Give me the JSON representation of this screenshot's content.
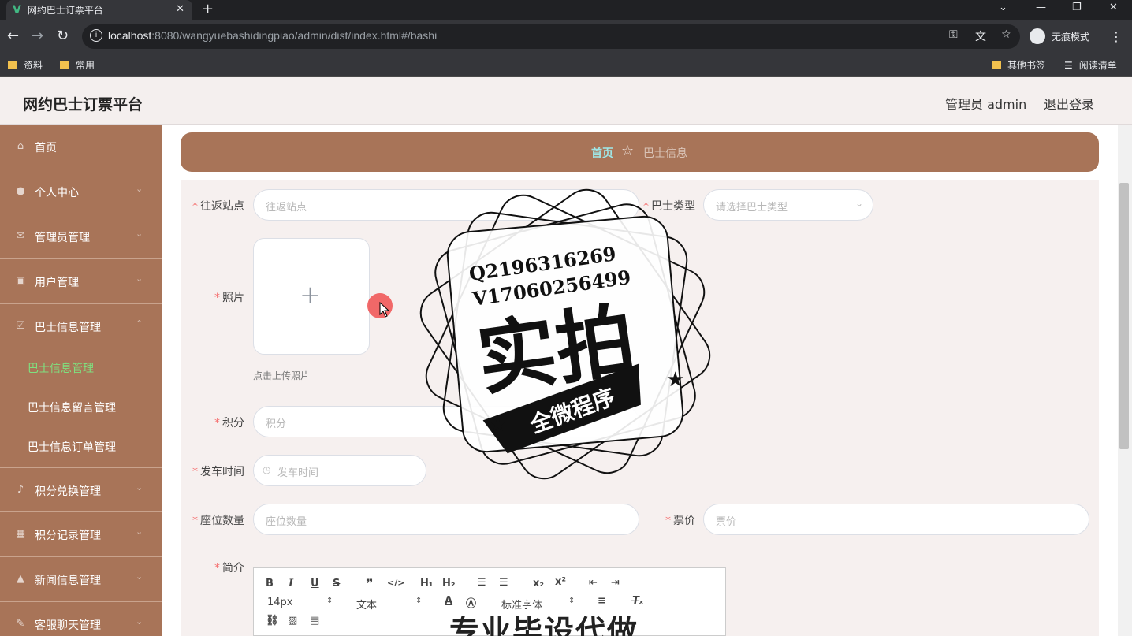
{
  "browser": {
    "tab_title": "网约巴士订票平台",
    "url_host": "localhost",
    "url_rest": ":8080/wangyuebashidingpiao/admin/dist/index.html#/bashi",
    "incognito_label": "无痕模式",
    "bookmarks": [
      "资料",
      "常用"
    ],
    "bookmarks_right": [
      "其他书签",
      "阅读清单"
    ]
  },
  "header": {
    "title": "网约巴士订票平台",
    "admin": "管理员 admin",
    "logout": "退出登录"
  },
  "sidebar": {
    "items": [
      {
        "label": "首页",
        "icon": "home-icon"
      },
      {
        "label": "个人中心",
        "icon": "user-icon"
      },
      {
        "label": "管理员管理",
        "icon": "mail-icon"
      },
      {
        "label": "用户管理",
        "icon": "document-icon"
      },
      {
        "label": "巴士信息管理",
        "icon": "check-icon"
      },
      {
        "label": "积分兑换管理",
        "icon": "microphone-icon"
      },
      {
        "label": "积分记录管理",
        "icon": "grid-icon"
      },
      {
        "label": "新闻信息管理",
        "icon": "thumb-icon"
      },
      {
        "label": "客服聊天管理",
        "icon": "chat-icon"
      }
    ],
    "subitems": [
      "巴士信息管理",
      "巴士信息留言管理",
      "巴士信息订单管理"
    ]
  },
  "breadcrumb": {
    "home": "首页",
    "current": "巴士信息"
  },
  "form": {
    "station_label": "往返站点",
    "station_placeholder": "往返站点",
    "bus_type_label": "巴士类型",
    "bus_type_placeholder": "请选择巴士类型",
    "photo_label": "照片",
    "photo_tip": "点击上传照片",
    "points_label": "积分",
    "points_placeholder": "积分",
    "depart_label": "发车时间",
    "depart_placeholder": "发车时间",
    "seats_label": "座位数量",
    "seats_placeholder": "座位数量",
    "price_label": "票价",
    "price_placeholder": "票价",
    "intro_label": "简介"
  },
  "editor": {
    "font_size": "14px",
    "block_type": "文本",
    "font_family": "标准字体"
  },
  "watermark": {
    "line1": "Q2196316269",
    "line2": "V17060256499",
    "main": "实拍",
    "banner": "全微程序",
    "bottom": "专业毕设代做"
  },
  "colors": {
    "sidebar": "#a87458",
    "header_bg": "#f4efee",
    "active_sub": "#7fe07f",
    "required": "#f56c6c"
  }
}
